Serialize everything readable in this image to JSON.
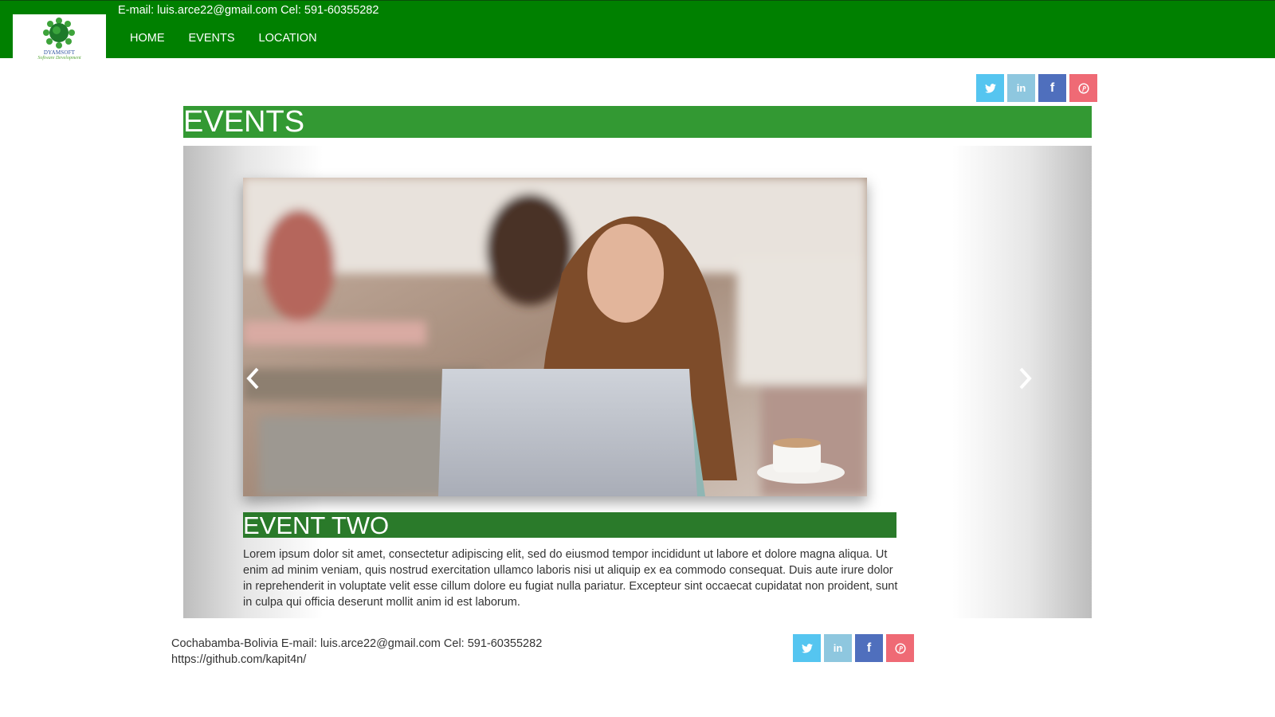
{
  "header": {
    "logo": {
      "name": "DYAMSOFT",
      "tagline": "Software Development"
    },
    "contact": "E-mail: luis.arce22@gmail.com Cel: 591-60355282",
    "nav": [
      {
        "label": "HOME"
      },
      {
        "label": "EVENTS"
      },
      {
        "label": "LOCATION"
      }
    ]
  },
  "social": {
    "items": [
      {
        "name": "twitter",
        "icon": "twitter-icon",
        "color": "#55c5f0"
      },
      {
        "name": "linkedin",
        "icon": "linkedin-icon",
        "color": "#8ec7df",
        "glyph": "in"
      },
      {
        "name": "facebook",
        "icon": "facebook-icon",
        "color": "#4f6fbd",
        "glyph": "f"
      },
      {
        "name": "pinterest",
        "icon": "pinterest-icon",
        "color": "#ef6a75"
      }
    ]
  },
  "main": {
    "heading": "EVENTS",
    "carousel": {
      "event_title": "EVENT TWO",
      "event_text": "Lorem ipsum dolor sit amet, consectetur adipiscing elit, sed do eiusmod tempor incididunt ut labore et dolore magna aliqua. Ut enim ad minim veniam, quis nostrud exercitation ullamco laboris nisi ut aliquip ex ea commodo consequat. Duis aute irure dolor in reprehenderit in voluptate velit esse cillum dolore eu fugiat nulla pariatur. Excepteur sint occaecat cupidatat non proident, sunt in culpa qui officia deserunt mollit anim id est laborum."
    }
  },
  "footer": {
    "contact": "Cochabamba-Bolivia E-mail: luis.arce22@gmail.com Cel: 591-60355282",
    "github": "https://github.com/kapit4n/"
  },
  "colors": {
    "brand_green": "#008000",
    "heading_green": "#339933",
    "event_title_green": "#2a7a2a"
  }
}
